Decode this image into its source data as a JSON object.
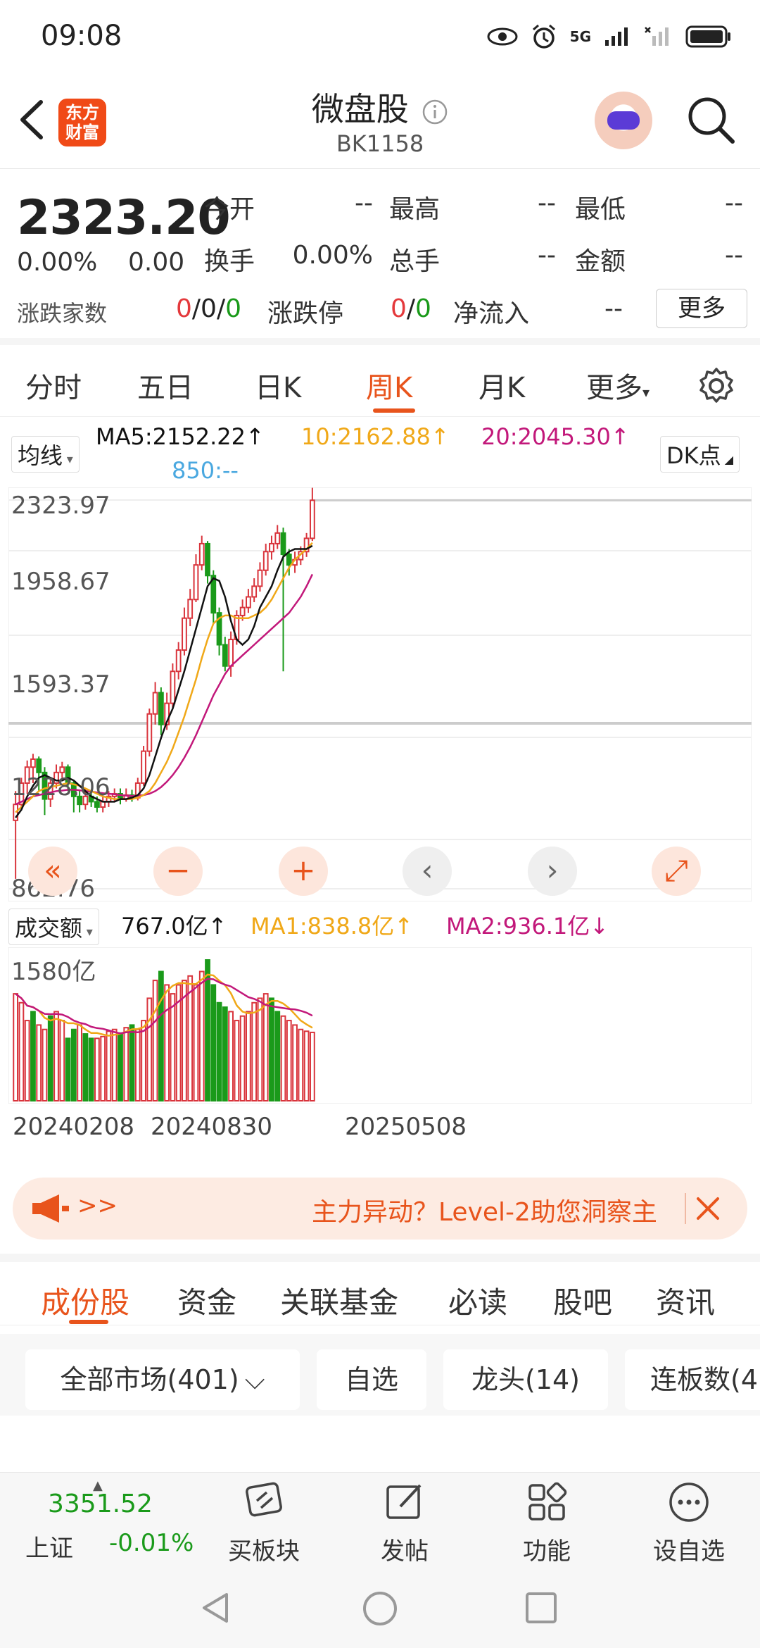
{
  "status_bar": {
    "time": "09:08",
    "network": "5G"
  },
  "header": {
    "logo_text_line1": "东方",
    "logo_text_line2": "财富",
    "title": "微盘股",
    "code": "BK1158"
  },
  "quote": {
    "price": "2323.20",
    "change_pct": "0.00%",
    "change": "0.00",
    "labels": {
      "open": "今开",
      "high": "最高",
      "low": "最低",
      "turnover": "换手",
      "total_hands": "总手",
      "amount": "金额",
      "up_down_count": "涨跌家数",
      "limit": "涨跌停",
      "net_inflow": "净流入"
    },
    "values": {
      "open": "--",
      "high": "--",
      "low": "--",
      "turnover": "0.00%",
      "total_hands": "--",
      "amount": "--",
      "up_count": "0",
      "flat_count": "0",
      "down_count": "0",
      "limit_up": "0",
      "limit_down": "0",
      "net_inflow": "--"
    },
    "more_button": "更多"
  },
  "period_tabs": {
    "items": [
      "分时",
      "五日",
      "日K",
      "周K",
      "月K",
      "更多"
    ],
    "active": "周K"
  },
  "ma_legend": {
    "selector": "均线",
    "ma5": "MA5:2152.22↑",
    "ma10": "10:2162.88↑",
    "ma20": "20:2045.30↑",
    "ma850": "850:--",
    "dk_button": "DK点",
    "colors": {
      "ma5": "#111111",
      "ma10": "#f0a818",
      "ma20": "#c2187a",
      "ma850": "#4aa8e0"
    }
  },
  "chart_data": {
    "type": "candlestick",
    "y_ticks": [
      "2323.97",
      "1958.67",
      "1593.37",
      "1228.06",
      "862.76"
    ],
    "ylim": [
      862.76,
      2323.97
    ],
    "x_ticks": [
      "20240208",
      "20240830",
      "20250508"
    ],
    "candles": [
      {
        "o": 1120,
        "c": 1180,
        "h": 1230,
        "l": 900
      },
      {
        "o": 1180,
        "c": 1260,
        "h": 1280,
        "l": 1160
      },
      {
        "o": 1260,
        "c": 1320,
        "h": 1345,
        "l": 1220
      },
      {
        "o": 1320,
        "c": 1350,
        "h": 1370,
        "l": 1260
      },
      {
        "o": 1350,
        "c": 1300,
        "h": 1360,
        "l": 1230
      },
      {
        "o": 1300,
        "c": 1200,
        "h": 1320,
        "l": 1140
      },
      {
        "o": 1200,
        "c": 1260,
        "h": 1280,
        "l": 1170
      },
      {
        "o": 1260,
        "c": 1300,
        "h": 1330,
        "l": 1240
      },
      {
        "o": 1300,
        "c": 1320,
        "h": 1340,
        "l": 1280
      },
      {
        "o": 1320,
        "c": 1260,
        "h": 1330,
        "l": 1230
      },
      {
        "o": 1260,
        "c": 1210,
        "h": 1270,
        "l": 1150
      },
      {
        "o": 1210,
        "c": 1180,
        "h": 1230,
        "l": 1150
      },
      {
        "o": 1180,
        "c": 1210,
        "h": 1240,
        "l": 1160
      },
      {
        "o": 1210,
        "c": 1190,
        "h": 1230,
        "l": 1170
      },
      {
        "o": 1190,
        "c": 1170,
        "h": 1210,
        "l": 1150
      },
      {
        "o": 1170,
        "c": 1190,
        "h": 1210,
        "l": 1150
      },
      {
        "o": 1190,
        "c": 1210,
        "h": 1230,
        "l": 1170
      },
      {
        "o": 1210,
        "c": 1220,
        "h": 1240,
        "l": 1190
      },
      {
        "o": 1220,
        "c": 1200,
        "h": 1240,
        "l": 1180
      },
      {
        "o": 1200,
        "c": 1215,
        "h": 1240,
        "l": 1190
      },
      {
        "o": 1215,
        "c": 1205,
        "h": 1235,
        "l": 1190
      },
      {
        "o": 1205,
        "c": 1260,
        "h": 1280,
        "l": 1195
      },
      {
        "o": 1260,
        "c": 1380,
        "h": 1400,
        "l": 1250
      },
      {
        "o": 1380,
        "c": 1520,
        "h": 1540,
        "l": 1360
      },
      {
        "o": 1520,
        "c": 1600,
        "h": 1640,
        "l": 1480
      },
      {
        "o": 1600,
        "c": 1480,
        "h": 1620,
        "l": 1440
      },
      {
        "o": 1480,
        "c": 1560,
        "h": 1600,
        "l": 1460
      },
      {
        "o": 1560,
        "c": 1680,
        "h": 1710,
        "l": 1540
      },
      {
        "o": 1680,
        "c": 1760,
        "h": 1790,
        "l": 1650
      },
      {
        "o": 1760,
        "c": 1880,
        "h": 1920,
        "l": 1740
      },
      {
        "o": 1880,
        "c": 1950,
        "h": 1990,
        "l": 1850
      },
      {
        "o": 1950,
        "c": 2080,
        "h": 2120,
        "l": 1940
      },
      {
        "o": 2080,
        "c": 2160,
        "h": 2190,
        "l": 2060
      },
      {
        "o": 2160,
        "c": 2040,
        "h": 2170,
        "l": 2010
      },
      {
        "o": 2040,
        "c": 1900,
        "h": 2060,
        "l": 1860
      },
      {
        "o": 1900,
        "c": 1780,
        "h": 1920,
        "l": 1740
      },
      {
        "o": 1780,
        "c": 1700,
        "h": 1810,
        "l": 1680
      },
      {
        "o": 1700,
        "c": 1800,
        "h": 1830,
        "l": 1660
      },
      {
        "o": 1800,
        "c": 1890,
        "h": 1910,
        "l": 1780
      },
      {
        "o": 1890,
        "c": 1920,
        "h": 1950,
        "l": 1870
      },
      {
        "o": 1920,
        "c": 1960,
        "h": 1990,
        "l": 1900
      },
      {
        "o": 1960,
        "c": 2000,
        "h": 2030,
        "l": 1940
      },
      {
        "o": 2000,
        "c": 2060,
        "h": 2090,
        "l": 1980
      },
      {
        "o": 2060,
        "c": 2130,
        "h": 2160,
        "l": 2040
      },
      {
        "o": 2130,
        "c": 2160,
        "h": 2190,
        "l": 2100
      },
      {
        "o": 2160,
        "c": 2200,
        "h": 2230,
        "l": 2140
      },
      {
        "o": 2200,
        "c": 2120,
        "h": 2220,
        "l": 1680
      },
      {
        "o": 2120,
        "c": 2080,
        "h": 2140,
        "l": 2040
      },
      {
        "o": 2080,
        "c": 2100,
        "h": 2130,
        "l": 2050
      },
      {
        "o": 2100,
        "c": 2130,
        "h": 2150,
        "l": 2080
      },
      {
        "o": 2130,
        "c": 2180,
        "h": 2200,
        "l": 2110
      },
      {
        "o": 2180,
        "c": 2323,
        "h": 2370,
        "l": 2170
      }
    ],
    "ma5": [
      1130,
      1160,
      1210,
      1250,
      1280,
      1290,
      1280,
      1270,
      1270,
      1280,
      1270,
      1250,
      1230,
      1210,
      1200,
      1190,
      1190,
      1190,
      1200,
      1200,
      1205,
      1215,
      1240,
      1290,
      1360,
      1430,
      1490,
      1540,
      1610,
      1680,
      1760,
      1840,
      1920,
      2000,
      2030,
      2020,
      1960,
      1870,
      1800,
      1780,
      1800,
      1850,
      1920,
      1960,
      2000,
      2060,
      2110,
      2130,
      2140,
      2140,
      2140,
      2152
    ],
    "ma10": [
      1150,
      1170,
      1190,
      1210,
      1230,
      1240,
      1245,
      1250,
      1255,
      1260,
      1255,
      1250,
      1240,
      1230,
      1220,
      1210,
      1205,
      1200,
      1200,
      1200,
      1200,
      1205,
      1215,
      1230,
      1260,
      1300,
      1340,
      1390,
      1450,
      1510,
      1580,
      1650,
      1730,
      1800,
      1860,
      1880,
      1890,
      1890,
      1880,
      1880,
      1880,
      1890,
      1900,
      1920,
      1950,
      1990,
      2030,
      2070,
      2100,
      2120,
      2140,
      2163
    ],
    "ma20": [
      1180,
      1190,
      1200,
      1210,
      1215,
      1220,
      1225,
      1230,
      1232,
      1235,
      1235,
      1233,
      1230,
      1228,
      1225,
      1222,
      1220,
      1218,
      1215,
      1213,
      1212,
      1212,
      1215,
      1220,
      1230,
      1245,
      1265,
      1290,
      1320,
      1355,
      1395,
      1440,
      1490,
      1540,
      1590,
      1630,
      1670,
      1700,
      1720,
      1740,
      1760,
      1780,
      1800,
      1820,
      1840,
      1860,
      1880,
      1900,
      1930,
      1960,
      2000,
      2045
    ]
  },
  "volume": {
    "selector": "成交额",
    "value": "767.0亿↑",
    "ma1": "MA1:838.8亿↑",
    "ma2": "MA2:936.1亿↓",
    "y_tick": "1580亿",
    "bars": [
      1200,
      1100,
      900,
      1000,
      850,
      800,
      950,
      1000,
      900,
      700,
      800,
      850,
      750,
      700,
      700,
      720,
      780,
      800,
      760,
      820,
      850,
      800,
      900,
      1150,
      1350,
      1450,
      1300,
      1200,
      1300,
      1350,
      1400,
      1300,
      1450,
      1580,
      1300,
      1100,
      1050,
      1000,
      900,
      950,
      1000,
      1100,
      1150,
      1200,
      1150,
      1000,
      950,
      900,
      850,
      800,
      780,
      767
    ],
    "bar_up": [
      true,
      true,
      true,
      false,
      true,
      true,
      false,
      true,
      true,
      false,
      false,
      true,
      false,
      false,
      true,
      true,
      true,
      true,
      false,
      true,
      false,
      true,
      true,
      true,
      true,
      false,
      true,
      true,
      true,
      true,
      true,
      true,
      true,
      false,
      false,
      false,
      false,
      true,
      true,
      true,
      true,
      true,
      true,
      true,
      false,
      false,
      true,
      true,
      true,
      true,
      true,
      true
    ]
  },
  "chart_controls": [
    "«",
    "−",
    "+",
    "‹",
    "›",
    "⤢"
  ],
  "banner": {
    "arrows": ">>",
    "text": "主力异动？Level-2助您洞察主"
  },
  "section_tabs": {
    "items": [
      "成份股",
      "资金",
      "关联基金",
      "必读",
      "股吧",
      "资讯"
    ],
    "active": "成份股"
  },
  "filters": [
    "全部市场(401)",
    "自选",
    "龙头(14)",
    "连板数(4"
  ],
  "bottom_nav": {
    "index_value": "3351.52",
    "index_name": "上证",
    "index_change": "-0.01%",
    "items": [
      "买板块",
      "发帖",
      "功能",
      "设自选"
    ]
  }
}
